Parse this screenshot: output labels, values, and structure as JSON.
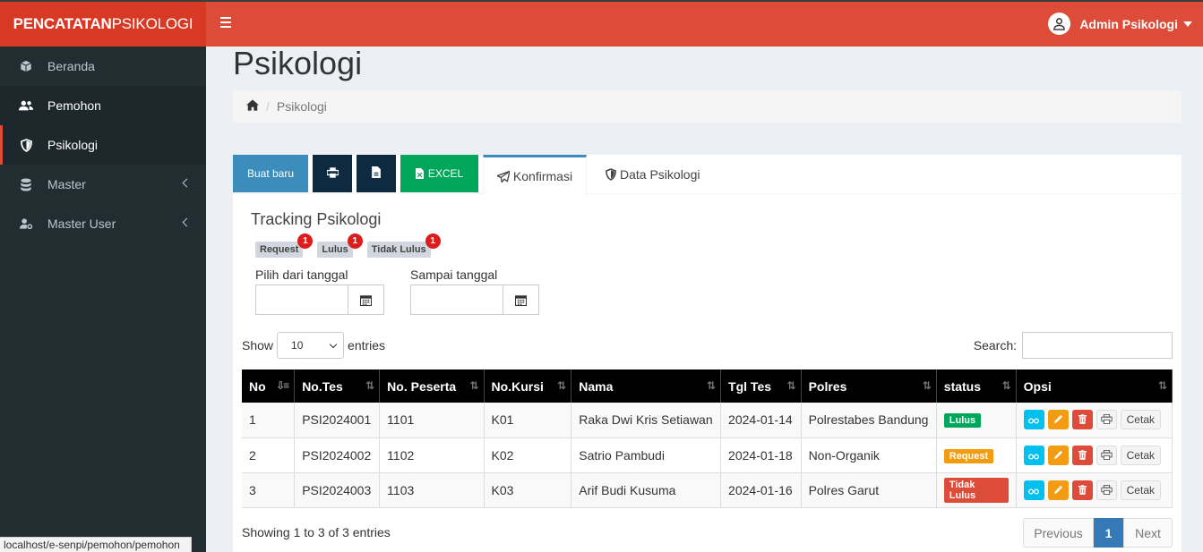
{
  "app": {
    "logo_bold": "PENCATATAN",
    "logo_rest": "PSIKOLOGI",
    "user_name": "Admin Psikologi"
  },
  "sidebar": {
    "items": [
      {
        "label": "Beranda",
        "icon": "cube-icon"
      },
      {
        "label": "Pemohon",
        "icon": "users-icon"
      },
      {
        "label": "Psikologi",
        "icon": "shield-icon"
      },
      {
        "label": "Master",
        "icon": "database-icon"
      },
      {
        "label": "Master User",
        "icon": "user-cog-icon"
      }
    ],
    "status_url": "localhost/e-senpi/pemohon/pemohon"
  },
  "page": {
    "title": "Psikologi",
    "breadcrumb": "Psikologi"
  },
  "toolbar": {
    "new_label": "Buat baru",
    "excel_label": "EXCEL",
    "tab_confirm": "Konfirmasi",
    "tab_data": "Data Psikologi"
  },
  "tracking": {
    "title": "Tracking Psikologi",
    "badges": [
      {
        "label": "Request",
        "count": "1"
      },
      {
        "label": "Lulus",
        "count": "1"
      },
      {
        "label": "Tidak Lulus",
        "count": "1"
      }
    ],
    "date_from_label": "Pilih dari tanggal",
    "date_to_label": "Sampai tanggal"
  },
  "table": {
    "show_label": "Show",
    "entries_value": "10",
    "entries_label": "entries",
    "search_label": "Search:",
    "headers": [
      "No",
      "No.Tes",
      "No. Peserta",
      "No.Kursi",
      "Nama",
      "Tgl Tes",
      "Polres",
      "status",
      "Opsi"
    ],
    "rows": [
      {
        "no": "1",
        "tes": "PSI2024001",
        "peserta": "1101",
        "kursi": "K01",
        "nama": "Raka Dwi Kris Setiawan",
        "tgl": "2024-01-14",
        "polres": "Polrestabes Bandung",
        "status": "Lulus",
        "status_color": "#00a65a"
      },
      {
        "no": "2",
        "tes": "PSI2024002",
        "peserta": "1102",
        "kursi": "K02",
        "nama": "Satrio Pambudi",
        "tgl": "2024-01-18",
        "polres": "Non-Organik",
        "status": "Request",
        "status_color": "#f39c12"
      },
      {
        "no": "3",
        "tes": "PSI2024003",
        "peserta": "1103",
        "kursi": "K03",
        "nama": "Arif Budi Kusuma",
        "tgl": "2024-01-16",
        "polres": "Polres Garut",
        "status": "Tidak Lulus",
        "status_color": "#dd4b39"
      }
    ],
    "cetak_label": "Cetak",
    "showing": "Showing 1 to 3 of 3 entries",
    "prev_label": "Previous",
    "page_current": "1",
    "next_label": "Next"
  }
}
